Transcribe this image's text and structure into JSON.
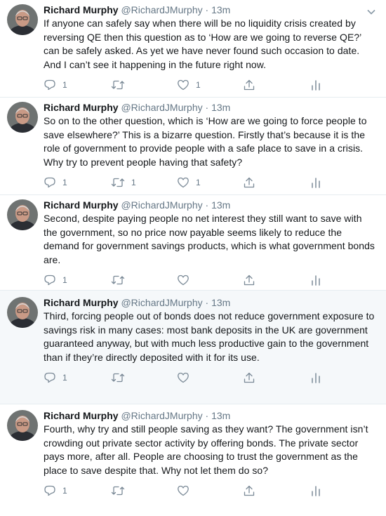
{
  "colors": {
    "text": "#14171a",
    "muted": "#657786",
    "icon": "#7b8a97",
    "divider": "#e6ecf0",
    "highlight_bg": "#f5f8fa"
  },
  "icons": {
    "reply": "reply-icon",
    "retweet": "retweet-icon",
    "like": "heart-icon",
    "share": "share-icon",
    "analytics": "analytics-icon",
    "more": "chevron-down-icon"
  },
  "tweets": [
    {
      "name": "Richard Murphy",
      "handle": "@RichardJMurphy",
      "dot": "·",
      "time": "13m",
      "text": "If anyone can safely say when there will be no liquidity crisis created by reversing QE then this question as to ‘How are we going to reverse QE?’ can be safely asked. As yet we have never found such occasion to date. And I can’t see it happening in the future right now.",
      "replies": "1",
      "retweets": "",
      "likes": "1"
    },
    {
      "name": "Richard Murphy",
      "handle": "@RichardJMurphy",
      "dot": "·",
      "time": "13m",
      "text": "So on to the other question, which is ‘How are we going to force people to save elsewhere?’ This is a bizarre question. Firstly that’s because it is the role of government to provide people with a safe place to save in a crisis. Why try to prevent people having that safety?",
      "replies": "1",
      "retweets": "1",
      "likes": "1"
    },
    {
      "name": "Richard Murphy",
      "handle": "@RichardJMurphy",
      "dot": "·",
      "time": "13m",
      "text": "Second, despite paying people no net interest they still want to save with the government, so no price now payable seems likely to reduce the demand for government savings products, which is what government bonds are.",
      "replies": "1",
      "retweets": "",
      "likes": ""
    },
    {
      "name": "Richard Murphy",
      "handle": "@RichardJMurphy",
      "dot": "·",
      "time": "13m",
      "text": "Third, forcing people out of bonds does not reduce government exposure to savings risk in many cases: most bank deposits in the UK are government guaranteed anyway, but with much less productive gain to the government than if they’re directly deposited with it for its use.",
      "replies": "1",
      "retweets": "",
      "likes": ""
    },
    {
      "name": "Richard Murphy",
      "handle": "@RichardJMurphy",
      "dot": "·",
      "time": "13m",
      "text": "Fourth, why try and still people saving as they want? The government isn’t crowding out private sector activity by offering bonds. The private sector pays more, after all. People are choosing to trust the government as the place to save despite that. Why not let them do so?",
      "replies": "1",
      "retweets": "",
      "likes": ""
    }
  ]
}
